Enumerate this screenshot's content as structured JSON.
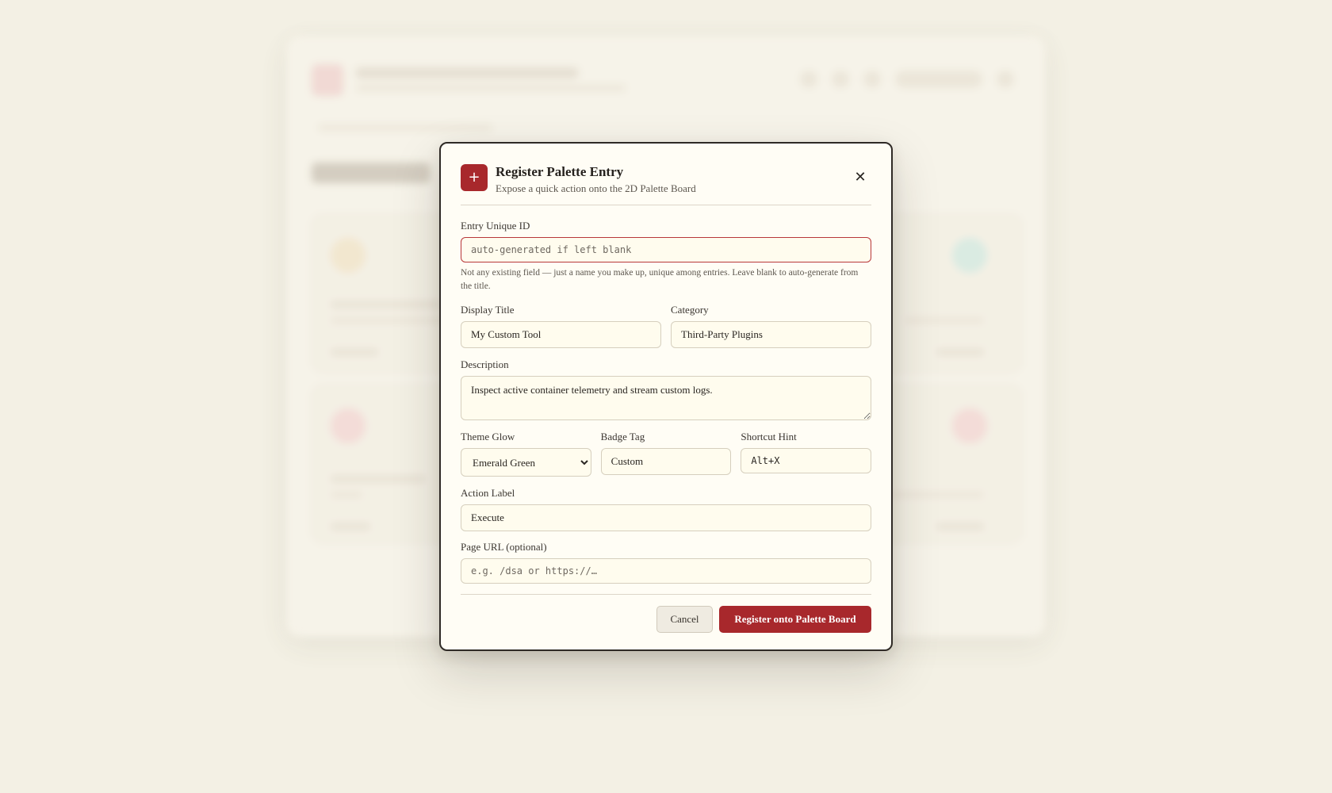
{
  "modal": {
    "title": "Register Palette Entry",
    "subtitle": "Expose a quick action onto the 2D Palette Board",
    "header_icon": "plus-icon",
    "close_icon": "close-icon"
  },
  "fields": {
    "entry_id": {
      "label": "Entry Unique ID",
      "value": "",
      "placeholder": "auto-generated if left blank",
      "helper": "Not any existing field — just a name you make up, unique among entries. Leave blank to auto-generate from the title."
    },
    "display_title": {
      "label": "Display Title",
      "value": "My Custom Tool"
    },
    "category": {
      "label": "Category",
      "value": "Third-Party Plugins"
    },
    "description": {
      "label": "Description",
      "value": "Inspect active container telemetry and stream custom logs."
    },
    "theme_glow": {
      "label": "Theme Glow",
      "selected": "Emerald Green"
    },
    "badge_tag": {
      "label": "Badge Tag",
      "value": "Custom"
    },
    "shortcut_hint": {
      "label": "Shortcut Hint",
      "value": "Alt+X"
    },
    "action_label": {
      "label": "Action Label",
      "value": "Execute"
    },
    "page_url": {
      "label": "Page URL (optional)",
      "value": "",
      "placeholder": "e.g. /dsa or https://…"
    }
  },
  "footer": {
    "cancel_label": "Cancel",
    "submit_label": "Register onto Palette Board"
  },
  "colors": {
    "accent": "#a8282c",
    "background": "#f3f0e4",
    "modal_bg": "#fffdf5",
    "input_bg": "#fffcee"
  }
}
